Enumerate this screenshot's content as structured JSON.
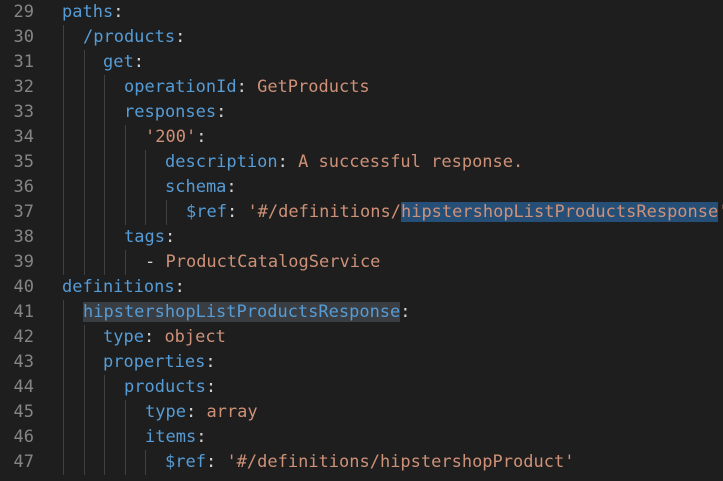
{
  "editor": {
    "lines": [
      {
        "num": "29",
        "key": "paths",
        "colon": ":",
        "value": ""
      },
      {
        "num": "30",
        "key": "/products",
        "colon": ":",
        "value": ""
      },
      {
        "num": "31",
        "key": "get",
        "colon": ":",
        "value": ""
      },
      {
        "num": "32",
        "key": "operationId",
        "colon": ": ",
        "value": "GetProducts"
      },
      {
        "num": "33",
        "key": "responses",
        "colon": ":",
        "value": ""
      },
      {
        "num": "34",
        "key": "'200'",
        "colon": ":",
        "value": ""
      },
      {
        "num": "35",
        "key": "description",
        "colon": ": ",
        "value": "A successful response."
      },
      {
        "num": "36",
        "key": "schema",
        "colon": ":",
        "value": ""
      },
      {
        "num": "37",
        "key": "$ref",
        "colon": ": ",
        "value_pre": "'#/definitions/",
        "value_sel": "hipstershopListProductsResponse",
        "value_post": "'"
      },
      {
        "num": "38",
        "key": "tags",
        "colon": ":",
        "value": ""
      },
      {
        "num": "39",
        "dash": "- ",
        "value": "ProductCatalogService"
      },
      {
        "num": "40",
        "key": "definitions",
        "colon": ":",
        "value": ""
      },
      {
        "num": "41",
        "key": "hipstershopListProductsResponse",
        "colon": ":",
        "value": ""
      },
      {
        "num": "42",
        "key": "type",
        "colon": ": ",
        "value": "object"
      },
      {
        "num": "43",
        "key": "properties",
        "colon": ":",
        "value": ""
      },
      {
        "num": "44",
        "key": "products",
        "colon": ":",
        "value": ""
      },
      {
        "num": "45",
        "key": "type",
        "colon": ": ",
        "value": "array"
      },
      {
        "num": "46",
        "key": "items",
        "colon": ":",
        "value": ""
      },
      {
        "num": "47",
        "key": "$ref",
        "colon": ": ",
        "value": "'#/definitions/hipstershopProduct'"
      }
    ]
  },
  "colors": {
    "background": "#1e1e1e",
    "key": "#569cd6",
    "string": "#ce9178",
    "line_number": "#858585",
    "selection": "#264f78"
  }
}
